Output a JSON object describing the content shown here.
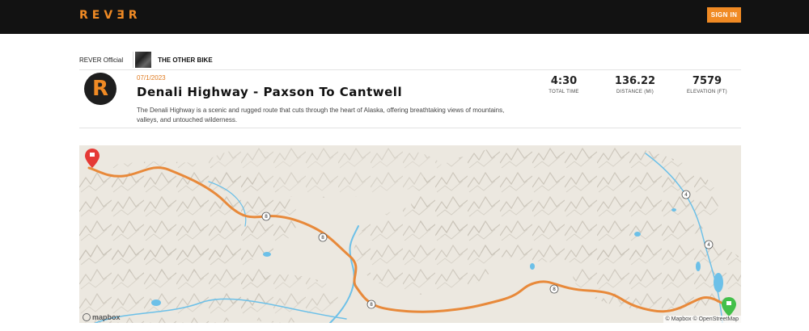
{
  "header": {
    "logo_text": "REVƎR",
    "signin_label": "SIGN IN",
    "accent_color": "#f08a24"
  },
  "breadcrumb": {
    "owner": "REVER Official",
    "collection": "THE OTHER BIKE"
  },
  "ride": {
    "avatar_letter": "R",
    "date": "07/1/2023",
    "title": "Denali Highway - Paxson To Cantwell",
    "description": "The Denali Highway is a scenic and rugged route that cuts through the heart of Alaska, offering breathtaking views of mountains, valleys, and untouched wilderness."
  },
  "stats": [
    {
      "value": "4:30",
      "label": "TOTAL TIME"
    },
    {
      "value": "136.22",
      "label": "DISTANCE (MI)"
    },
    {
      "value": "7579",
      "label": "ELEVATION (FT)"
    }
  ],
  "map": {
    "route_color": "#e8893a",
    "start_marker_color": "#e53935",
    "end_marker_color": "#43c04a",
    "water_color": "#6cc0e8",
    "shield_labels": [
      "8",
      "8",
      "8",
      "8",
      "8",
      "4",
      "4"
    ],
    "mapbox_label": "mapbox",
    "attribution": "© Mapbox © OpenStreetMap"
  }
}
